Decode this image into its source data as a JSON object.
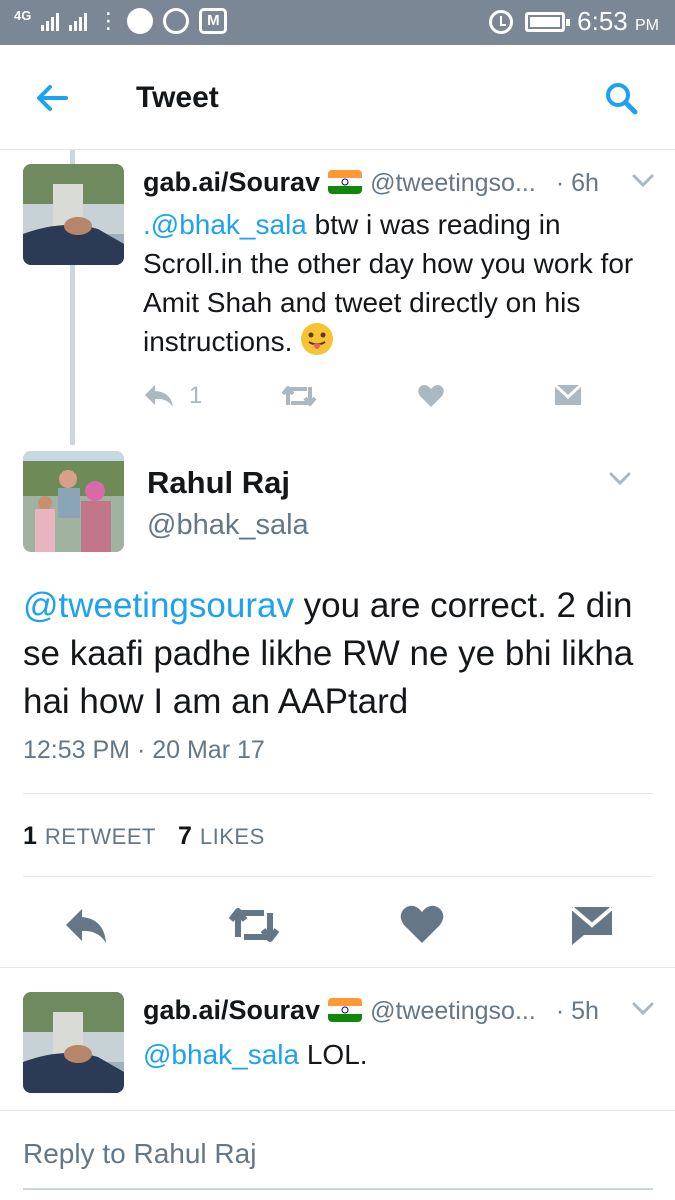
{
  "status_bar": {
    "network": "4G",
    "sim2": "2",
    "time": "6:53",
    "ampm": "PM",
    "icons": [
      "signal-icon",
      "signal-icon",
      "more-vert-icon",
      "circle-icon",
      "whatsapp-icon",
      "gmail-icon",
      "alarm-icon",
      "battery-icon"
    ]
  },
  "header": {
    "title": "Tweet",
    "back_icon": "arrow-left-icon",
    "search_icon": "search-icon"
  },
  "colors": {
    "accent": "#1da1f2",
    "text": "#14171a",
    "secondary": "#657786",
    "action_gray": "#aab8c2",
    "status_bar": "#7b8794"
  },
  "parent_tweet": {
    "name": "gab.ai/Sourav",
    "handle": "@tweetingso...",
    "time": "· 6h",
    "mention": ".@bhak_sala",
    "text": " btw i was reading in Scroll.in the other day how you work for Amit Shah and tweet directly on his instructions. ",
    "emoji": "face-with-tongue",
    "reply_count": "1"
  },
  "main_tweet": {
    "name": "Rahul Raj",
    "handle": "@bhak_sala",
    "mention": "@tweetingsourav",
    "text": " you are correct. 2 din se kaafi padhe likhe RW ne ye bhi likha hai how I am an AAPtard",
    "timestamp": "12:53 PM · 20 Mar 17",
    "retweet_count": "1",
    "retweet_label": "RETWEET",
    "like_count": "7",
    "like_label": "LIKES"
  },
  "reply_tweet": {
    "name": "gab.ai/Sourav",
    "handle": "@tweetingso...",
    "time": "· 5h",
    "mention": "@bhak_sala",
    "text": " LOL."
  },
  "reply_prompt": "Reply to Rahul Raj"
}
